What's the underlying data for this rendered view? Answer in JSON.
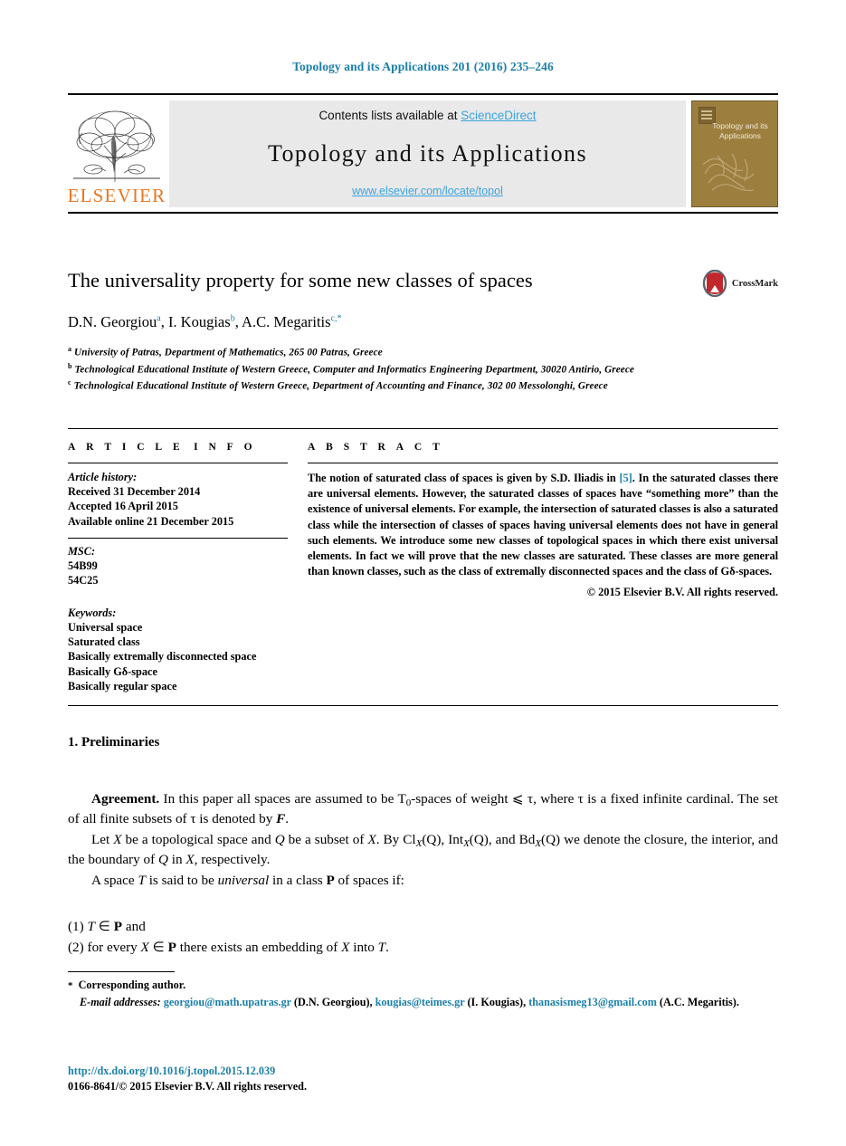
{
  "running_head": "Topology and its Applications 201 (2016) 235–246",
  "masthead": {
    "contents_prefix": "Contents lists available at ",
    "sciencedirect": "ScienceDirect",
    "journal_title": "Topology and its Applications",
    "journal_url": "www.elsevier.com/locate/topol",
    "publisher_logo_text": "ELSEVIER",
    "cover_title": "Topology and its Applications",
    "link_color": "#3ba3dd",
    "cover_color": "#9c7f3f",
    "elsevier_orange": "#e87722"
  },
  "article": {
    "title": "The universality property for some new classes of spaces",
    "crossmark_label": "CrossMark",
    "authors": [
      {
        "name": "D.N. Georgiou",
        "marks": "a"
      },
      {
        "name": "I. Kougias",
        "marks": "b"
      },
      {
        "name": "A.C. Megaritis",
        "marks": "c,*"
      }
    ],
    "authors_separator": ", ",
    "affiliations": [
      {
        "mark": "a",
        "text": "University of Patras, Department of Mathematics, 265 00 Patras, Greece"
      },
      {
        "mark": "b",
        "text": "Technological Educational Institute of Western Greece, Computer and Informatics Engineering Department, 30020 Antirio, Greece"
      },
      {
        "mark": "c",
        "text": "Technological Educational Institute of Western Greece, Department of Accounting and Finance, 302 00 Messolonghi, Greece"
      }
    ]
  },
  "article_info": {
    "heading": "ARTICLE INFO",
    "history_label": "Article history:",
    "history": [
      "Received 31 December 2014",
      "Accepted 16 April 2015",
      "Available online 21 December 2015"
    ],
    "msc_label": "MSC:",
    "msc": [
      "54B99",
      "54C25"
    ],
    "keywords_label": "Keywords:",
    "keywords": [
      "Universal space",
      "Saturated class",
      "Basically extremally disconnected space",
      "Basically Gδ-space",
      "Basically regular space"
    ]
  },
  "abstract": {
    "heading": "ABSTRACT",
    "part1": "The notion of saturated class of spaces is given by S.D. Iliadis in ",
    "reference": "[5]",
    "part2": ". In the saturated classes there are universal elements. However, the saturated classes of spaces have “something more” than the existence of universal elements. For example, the intersection of saturated classes is also a saturated class while the intersection of classes of spaces having universal elements does not have in general such elements. We introduce some new classes of topological spaces in which there exist universal elements. In fact we will prove that the new classes are saturated. These classes are more general than known classes, such as the class of extremally disconnected spaces and the class of Gδ-spaces.",
    "copyright": "© 2015 Elsevier B.V. All rights reserved."
  },
  "body": {
    "section_number_title": "1. Preliminaries",
    "agreement_label": "Agreement.",
    "agreement_text_1": " In this paper all spaces are assumed to be T",
    "agreement_sub_0": "0",
    "agreement_text_2": "-spaces of weight ⩽ τ, where τ is a fixed infinite cardinal. The set of all finite subsets of τ is denoted by ",
    "agreement_script_F": "F",
    "agreement_text_3": ".",
    "para2_a": "Let ",
    "para2_X": "X",
    "para2_b": " be a topological space and ",
    "para2_Q": "Q",
    "para2_c": " be a subset of ",
    "para2_X2": "X",
    "para2_d": ". By Cl",
    "para2_subX1": "X",
    "para2_e": "(Q), Int",
    "para2_subX2": "X",
    "para2_f": "(Q), and Bd",
    "para2_subX3": "X",
    "para2_g": "(Q) we denote the closure, the interior, and the boundary of ",
    "para2_Q2": "Q",
    "para2_h": " in ",
    "para2_X3": "X",
    "para2_i": ", respectively.",
    "para3_a": "A space ",
    "para3_T": "T",
    "para3_b": " is said to be ",
    "para3_universal": "universal",
    "para3_c": " in a class ",
    "para3_P": "P",
    "para3_d": " of spaces if:",
    "list": [
      {
        "num": "(1)",
        "text_a": "T",
        "text_b": " ∈ ",
        "text_c": "P",
        "text_d": " and"
      },
      {
        "num": "(2)",
        "text_a": "for every ",
        "text_b": "X",
        "text_c": " ∈ ",
        "text_d": "P",
        "text_e": " there exists an embedding of ",
        "text_f": "X",
        "text_g": " into ",
        "text_h": "T",
        "text_i": "."
      }
    ]
  },
  "footer": {
    "star": "*",
    "corresponding": "Corresponding author.",
    "email_label": "E-mail addresses:",
    "emails": [
      {
        "address": "georgiou@math.upatras.gr",
        "owner": "(D.N. Georgiou),"
      },
      {
        "address": "kougias@teimes.gr",
        "owner": "(I. Kougias),"
      },
      {
        "address": "thanasismeg13@gmail.com",
        "owner": ""
      }
    ],
    "last_owner": "(A.C. Megaritis).",
    "doi": "http://dx.doi.org/10.1016/j.topol.2015.12.039",
    "issn_line": "0166-8641/© 2015 Elsevier B.V. All rights reserved."
  }
}
